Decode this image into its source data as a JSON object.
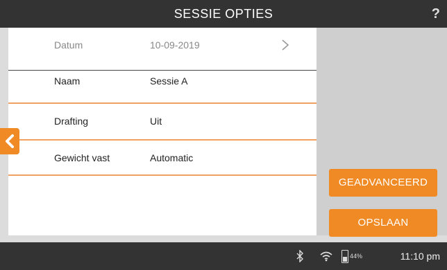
{
  "header": {
    "title": "SESSIE OPTIES",
    "help": "?"
  },
  "rows": [
    {
      "label": "Datum",
      "value": "10-09-2019"
    },
    {
      "label": "Naam",
      "value": "Sessie A"
    },
    {
      "label": "Drafting",
      "value": "Uit"
    },
    {
      "label": "Gewicht vast",
      "value": "Automatic"
    }
  ],
  "buttons": {
    "advanced": "GEADVANCEERD",
    "save": "OPSLAAN"
  },
  "status": {
    "battery": "44%",
    "time": "11:10 pm"
  },
  "colors": {
    "accent": "#f08a24",
    "bar": "#333333",
    "side": "#cfcfcf"
  },
  "icons": {
    "back": "chevron-left-icon",
    "next": "chevron-right-icon",
    "bluetooth": "bluetooth-icon",
    "wifi": "wifi-icon",
    "battery": "battery-icon"
  }
}
